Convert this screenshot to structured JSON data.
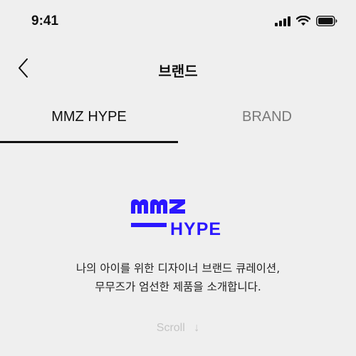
{
  "status": {
    "time": "9:41",
    "icons": [
      "signal-icon",
      "wifi-icon",
      "battery-icon"
    ]
  },
  "nav": {
    "back_icon": "chevron-left-icon",
    "title": "브랜드"
  },
  "tabs": [
    {
      "label": "MMZ HYPE",
      "active": true
    },
    {
      "label": "BRAND",
      "active": false
    }
  ],
  "logo": {
    "text_line1": "MMZ",
    "text_line2": "HYPE",
    "color": "#2b17ff"
  },
  "intro": {
    "line1": "나의 아이를 위한 디자이너 브랜드 큐레이션,",
    "line2": "무무즈가 엄선한 제품을 소개합니다."
  },
  "scroll_hint": {
    "label": "Scroll",
    "arrow": "↓"
  },
  "colors": {
    "background": "#efefef",
    "text": "#111111",
    "muted": "#7a7a7a",
    "accent": "#2b17ff",
    "hint": "#c4c4c4"
  }
}
